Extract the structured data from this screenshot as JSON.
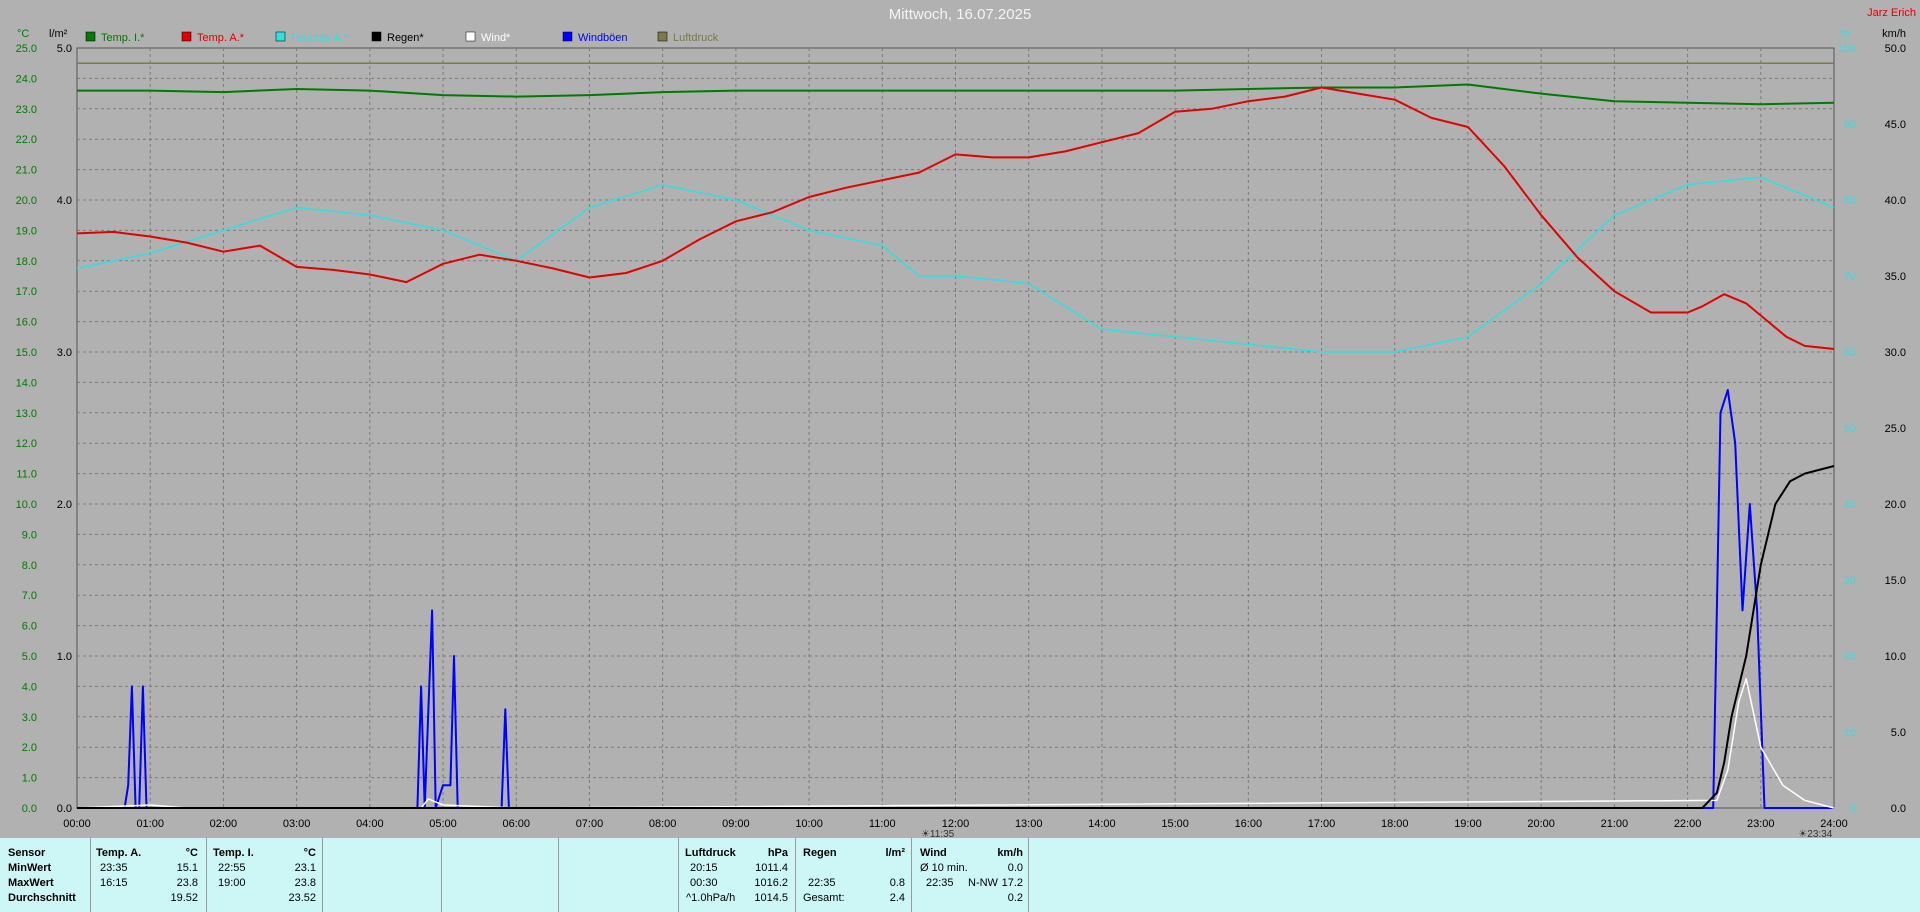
{
  "title": "Mittwoch, 16.07.2025",
  "corner_label": "Jarz Erich",
  "axis_units": {
    "left1": "°C",
    "left2": "l/m²",
    "right1": "%",
    "right2": "km/h"
  },
  "legend": [
    {
      "label": "Temp. I.*",
      "color": "#007a00"
    },
    {
      "label": "Temp. A.*",
      "color": "#e00000"
    },
    {
      "label": "Feuchte A.*",
      "color": "#2ee0e0"
    },
    {
      "label": "Regen*",
      "color": "#000000"
    },
    {
      "label": "Wind*",
      "color": "#ffffff"
    },
    {
      "label": "Windböen",
      "color": "#0000ff"
    },
    {
      "label": "Luftdruck",
      "color": "#7a7a4a"
    }
  ],
  "markers": [
    {
      "label": "11:35",
      "hour": 11.583
    },
    {
      "label": "23:34",
      "hour": 23.567
    }
  ],
  "chart_data": {
    "type": "line",
    "x_ticks": [
      "00:00",
      "01:00",
      "02:00",
      "03:00",
      "04:00",
      "05:00",
      "06:00",
      "07:00",
      "08:00",
      "09:00",
      "10:00",
      "11:00",
      "12:00",
      "13:00",
      "14:00",
      "15:00",
      "16:00",
      "17:00",
      "18:00",
      "19:00",
      "20:00",
      "21:00",
      "22:00",
      "23:00",
      "24:00"
    ],
    "xlim": [
      0,
      24
    ],
    "temp_axis": {
      "ticks": [
        "0.0",
        "1.0",
        "2.0",
        "3.0",
        "4.0",
        "5.0",
        "6.0",
        "7.0",
        "8.0",
        "9.0",
        "10.0",
        "11.0",
        "12.0",
        "13.0",
        "14.0",
        "15.0",
        "16.0",
        "17.0",
        "18.0",
        "19.0",
        "20.0",
        "21.0",
        "22.0",
        "23.0",
        "24.0",
        "25.0"
      ],
      "range": [
        0,
        25
      ]
    },
    "rain_axis": {
      "ticks": [
        "0.0",
        "1.0",
        "2.0",
        "3.0",
        "4.0",
        "5.0"
      ],
      "range": [
        0,
        5
      ]
    },
    "humidity_axis": {
      "ticks": [
        "0",
        "10",
        "20",
        "30",
        "40",
        "50",
        "60",
        "70",
        "80",
        "90",
        "100"
      ],
      "range": [
        0,
        100
      ]
    },
    "wind_axis": {
      "ticks": [
        "0.0",
        "5.0",
        "10.0",
        "15.0",
        "20.0",
        "25.0",
        "30.0",
        "35.0",
        "40.0",
        "45.0",
        "50.0"
      ],
      "range": [
        0,
        50
      ]
    },
    "series": [
      {
        "name": "Temp. I.*",
        "axis": "temp",
        "x": [
          0,
          1,
          2,
          3,
          4,
          5,
          6,
          7,
          8,
          9,
          10,
          11,
          12,
          13,
          14,
          15,
          16,
          17,
          18,
          19,
          20,
          21,
          22,
          23,
          24
        ],
        "y": [
          23.6,
          23.6,
          23.55,
          23.65,
          23.6,
          23.45,
          23.4,
          23.45,
          23.55,
          23.6,
          23.6,
          23.6,
          23.6,
          23.6,
          23.6,
          23.6,
          23.65,
          23.7,
          23.7,
          23.8,
          23.5,
          23.25,
          23.2,
          23.15,
          23.2
        ]
      },
      {
        "name": "Temp. A.*",
        "axis": "temp",
        "x": [
          0,
          0.5,
          1,
          1.5,
          2,
          2.5,
          3,
          3.5,
          4,
          4.5,
          5,
          5.5,
          6,
          6.5,
          7,
          7.5,
          8,
          8.5,
          9,
          9.5,
          10,
          10.5,
          11,
          11.5,
          12,
          12.5,
          13,
          13.5,
          14,
          14.5,
          15,
          15.5,
          16,
          16.5,
          17,
          17.5,
          18,
          18.5,
          19,
          19.5,
          20,
          20.5,
          21,
          21.5,
          22,
          22.2,
          22.5,
          22.8,
          23,
          23.35,
          23.6,
          24
        ],
        "y": [
          18.9,
          18.95,
          18.8,
          18.6,
          18.3,
          18.5,
          17.8,
          17.7,
          17.55,
          17.3,
          17.9,
          18.2,
          18.0,
          17.75,
          17.45,
          17.6,
          18.0,
          18.7,
          19.3,
          19.6,
          20.1,
          20.4,
          20.65,
          20.9,
          21.5,
          21.4,
          21.4,
          21.6,
          21.9,
          22.2,
          22.9,
          23.0,
          23.25,
          23.4,
          23.7,
          23.5,
          23.3,
          22.7,
          22.4,
          21.1,
          19.5,
          18.1,
          17.0,
          16.3,
          16.3,
          16.5,
          16.9,
          16.6,
          16.2,
          15.5,
          15.2,
          15.1
        ]
      },
      {
        "name": "Feuchte A.*",
        "axis": "humidity",
        "x": [
          0,
          1,
          2,
          3,
          4,
          5,
          6,
          7,
          8,
          9,
          10,
          11,
          11.5,
          12,
          13,
          14,
          15,
          16,
          17,
          18,
          19,
          20,
          21,
          22,
          23,
          24
        ],
        "y": [
          71,
          73,
          76,
          79,
          78,
          76,
          72,
          79,
          82,
          80,
          76,
          74,
          70,
          70,
          69,
          63,
          62,
          61,
          60,
          60,
          62,
          69,
          78,
          82,
          83,
          79
        ]
      },
      {
        "name": "Regen*",
        "axis": "rain",
        "x": [
          0,
          22.2,
          22.4,
          22.5,
          22.6,
          22.8,
          23,
          23.2,
          23.4,
          23.6,
          24
        ],
        "y": [
          0,
          0,
          0.1,
          0.3,
          0.6,
          1.0,
          1.6,
          2.0,
          2.15,
          2.2,
          2.25
        ]
      },
      {
        "name": "Wind*",
        "axis": "wind",
        "x": [
          0,
          1,
          1.5,
          4.7,
          4.8,
          5,
          6,
          22.4,
          22.55,
          22.7,
          22.8,
          23,
          23.3,
          23.6,
          24
        ],
        "y": [
          0,
          0.2,
          0,
          0,
          0.6,
          0.2,
          0,
          0.5,
          2.5,
          7.0,
          8.5,
          4.0,
          1.5,
          0.5,
          0
        ]
      },
      {
        "name": "Windböen",
        "axis": "wind",
        "x": [
          0,
          0.65,
          0.7,
          0.75,
          0.8,
          0.85,
          0.9,
          0.95,
          1.0,
          4.65,
          4.7,
          4.75,
          4.85,
          4.9,
          5.0,
          5.1,
          5.15,
          5.2,
          5.8,
          5.85,
          5.9,
          22.35,
          22.45,
          22.55,
          22.65,
          22.75,
          22.85,
          22.95,
          23.05,
          24
        ],
        "y": [
          0,
          0,
          1.5,
          8.0,
          0,
          0,
          8.0,
          0,
          0,
          0,
          8.0,
          0,
          13.0,
          0,
          1.5,
          1.5,
          10.0,
          0,
          0,
          6.5,
          0,
          0,
          26.0,
          27.5,
          24.0,
          13.0,
          20.0,
          13.0,
          0,
          0
        ]
      },
      {
        "name": "Luftdruck",
        "axis": "humidity",
        "x": [
          0,
          24
        ],
        "y": [
          98,
          98
        ]
      }
    ]
  },
  "stats": {
    "sensor_header": "Sensor",
    "row_labels": [
      "MinWert",
      "MaxWert",
      "Durchschnitt"
    ],
    "temp_a": {
      "header": "Temp. A.",
      "unit": "°C",
      "rows": [
        [
          "23:35",
          "15.1"
        ],
        [
          "16:15",
          "23.8"
        ],
        [
          "",
          "19.52"
        ]
      ]
    },
    "temp_i": {
      "header": "Temp. I.",
      "unit": "°C",
      "rows": [
        [
          "22:55",
          "23.1"
        ],
        [
          "19:00",
          "23.8"
        ],
        [
          "",
          "23.52"
        ]
      ]
    },
    "pressure": {
      "header": "Luftdruck",
      "unit": "hPa",
      "rows": [
        [
          "20:15",
          "1011.4"
        ],
        [
          "00:30",
          "1016.2"
        ],
        [
          "^1.0hPa/h",
          "1014.5"
        ]
      ]
    },
    "rain": {
      "header": "Regen",
      "unit": "l/m²",
      "rows": [
        [
          "",
          ""
        ],
        [
          "22:35",
          "0.8"
        ],
        [
          "Gesamt:",
          "2.4"
        ]
      ]
    },
    "wind": {
      "header": "Wind",
      "unit": "km/h",
      "rows": [
        [
          "Ø 10 min.",
          "",
          "0.0"
        ],
        [
          "22:35",
          "N-NW",
          "17.2"
        ],
        [
          "",
          "",
          "0.2"
        ]
      ]
    }
  }
}
